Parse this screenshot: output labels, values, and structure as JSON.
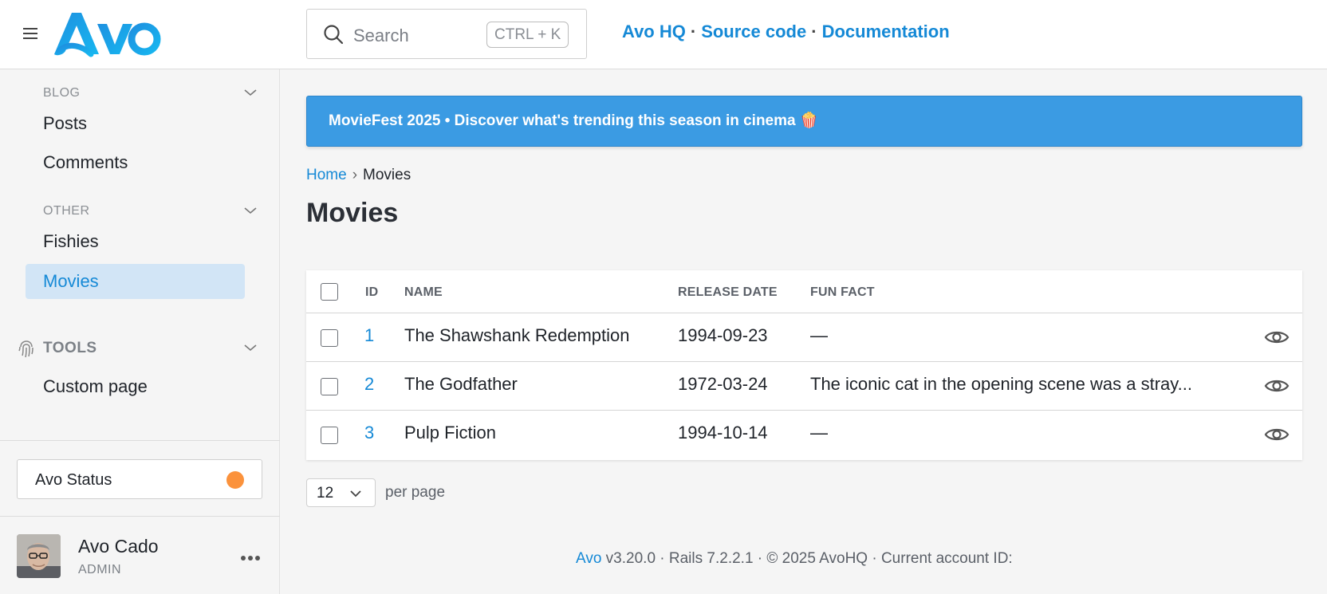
{
  "header": {
    "search": {
      "placeholder": "Search",
      "shortcut": "CTRL + K"
    },
    "links": [
      {
        "label": "Avo HQ"
      },
      {
        "label": "Source code"
      },
      {
        "label": "Documentation"
      }
    ],
    "separator": "·"
  },
  "sidebar": {
    "sections": [
      {
        "title": "BLOG",
        "items": [
          "Posts",
          "Comments"
        ]
      },
      {
        "title": "OTHER",
        "items": [
          "Fishies",
          "Movies"
        ],
        "active": "Movies"
      },
      {
        "title": "TOOLS",
        "items": [
          "Custom page"
        ]
      }
    ],
    "status": {
      "label": "Avo Status",
      "color": "#fb923c"
    },
    "user": {
      "name": "Avo Cado",
      "role": "ADMIN"
    }
  },
  "banner": {
    "text": "MovieFest 2025 • Discover what's trending this season in cinema 🍿"
  },
  "breadcrumb": {
    "home": "Home",
    "current": "Movies"
  },
  "page": {
    "title": "Movies"
  },
  "table": {
    "columns": [
      "ID",
      "NAME",
      "RELEASE DATE",
      "FUN FACT"
    ],
    "rows": [
      {
        "id": "1",
        "name": "The Shawshank Redemption",
        "release_date": "1994-09-23",
        "fun_fact": "—"
      },
      {
        "id": "2",
        "name": "The Godfather",
        "release_date": "1972-03-24",
        "fun_fact": "The iconic cat in the opening scene was a stray..."
      },
      {
        "id": "3",
        "name": "Pulp Fiction",
        "release_date": "1994-10-14",
        "fun_fact": "—"
      }
    ]
  },
  "pagination": {
    "per_page_value": "12",
    "per_page_label": "per page"
  },
  "footer": {
    "brand": "Avo",
    "text": " v3.20.0 · Rails 7.2.2.1 · © 2025 AvoHQ · Current account ID:"
  },
  "colors": {
    "accent": "#1589d6",
    "banner": "#3b9be3",
    "active_nav_bg": "#d2e5f6"
  }
}
